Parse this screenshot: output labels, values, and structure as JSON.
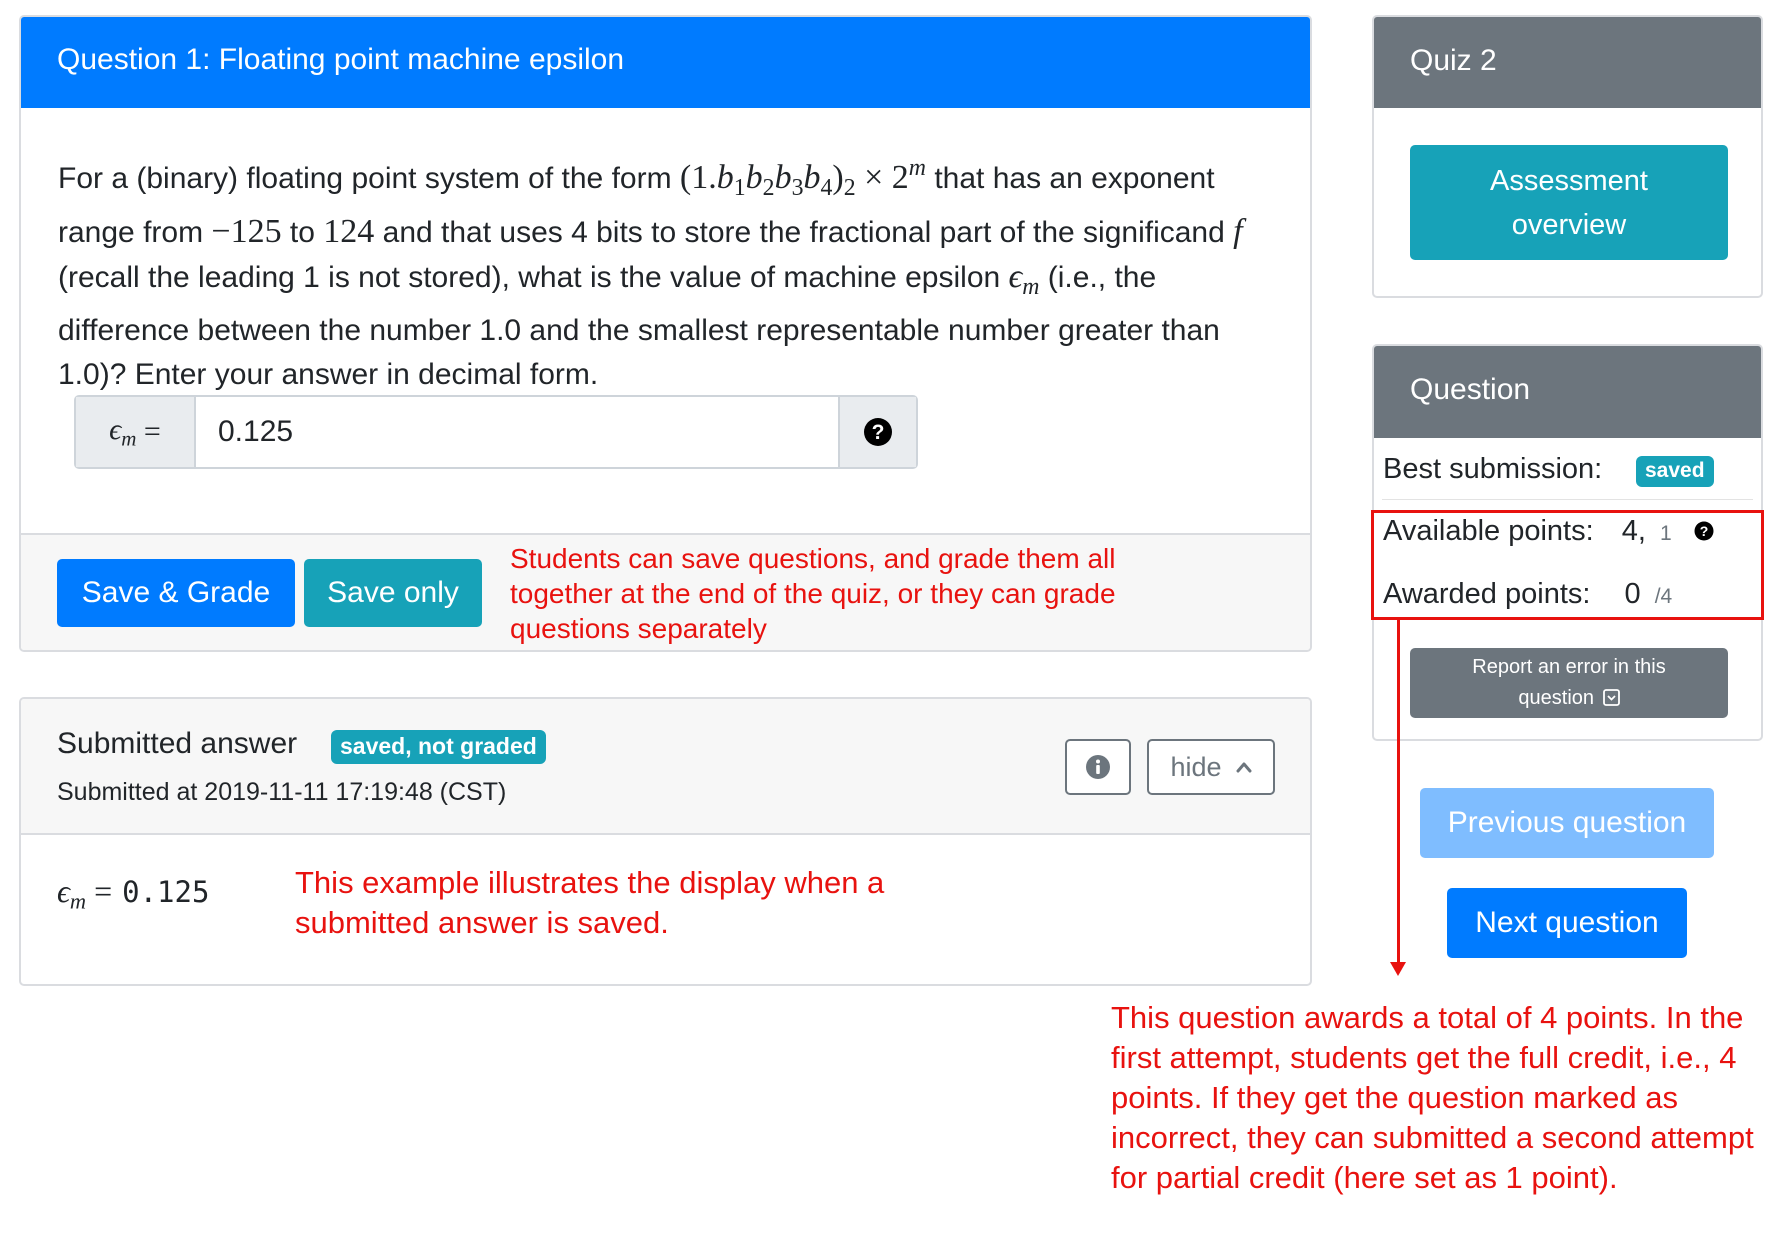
{
  "question_card": {
    "title": "Question 1: Floating point machine epsilon",
    "text": {
      "p1": "For a (binary) floating point system of the form ",
      "form": "(1.b₁b₂b₃b₄)₂ × 2ᵐ",
      "p2": " that has an exponent range from ",
      "emin": "−125",
      "to": " to ",
      "emax": "124",
      "p3": " and that uses 4 bits to store the fractional part of the significand ",
      "f": "f",
      "p4": " (recall the leading 1 is not stored), what is the value of machine epsilon ",
      "eps": "ϵm",
      "p5": " (i.e., the difference between the number 1.0 and the smallest representable number greater than 1.0)? Enter your answer in decimal form."
    },
    "answer_label": "ϵm =",
    "answer_value": "0.125",
    "grade_button": "Save & Grade",
    "save_button": "Save only",
    "save_note": "Students can save questions, and grade them all together at the end of the quiz, or they can grade questions separately"
  },
  "submitted_card": {
    "title": "Submitted answer",
    "badge": "saved, not graded",
    "timestamp": "Submitted at 2019-11-11 17:19:48 (CST)",
    "hide_button": "hide",
    "answer_label": "ϵm =",
    "answer_value": "0.125",
    "example_note": "This example illustrates the display when a submitted answer is saved."
  },
  "quiz_card": {
    "title": "Quiz 2",
    "overview_button_line1": "Assessment",
    "overview_button_line2": "overview"
  },
  "question_info": {
    "title": "Question",
    "best_label": "Best submission:",
    "best_badge": "saved",
    "available_label": "Available points:",
    "available_value": "4,",
    "available_next": "1",
    "awarded_label": "Awarded points:",
    "awarded_value": "0",
    "awarded_max": "/4",
    "report_line1": "Report an error in this",
    "report_line2": "question"
  },
  "nav": {
    "previous": "Previous question",
    "next": "Next question"
  },
  "points_note": "This question awards a total of 4 points. In the first attempt, students get the full credit, i.e., 4 points. If they get the question marked as incorrect, they can submitted a second attempt for partial credit (here set as 1 point).",
  "colors": {
    "primary": "#007bff",
    "info": "#17a2b8",
    "secondary": "#6c757d",
    "annotation": "#e8120f"
  }
}
